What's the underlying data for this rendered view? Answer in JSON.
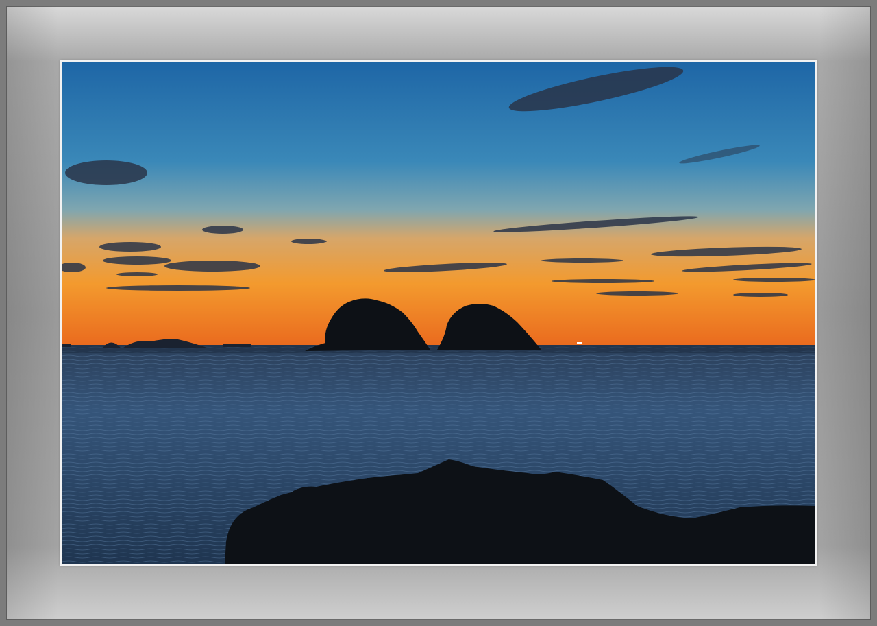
{
  "image": {
    "subject": "sunset-seascape",
    "colors": {
      "sky_top": "#1f6aa8",
      "sky_mid": "#4f93b8",
      "horizon_glow": "#f39a2e",
      "horizon_deep": "#e86a1c",
      "sea": "#2a4766",
      "silhouette": "#0d1116",
      "frame": "#9a9a9a",
      "mat": "#f2f2f2"
    },
    "icons": [
      "island-silhouette",
      "rock-silhouette",
      "cloud-streak"
    ]
  }
}
